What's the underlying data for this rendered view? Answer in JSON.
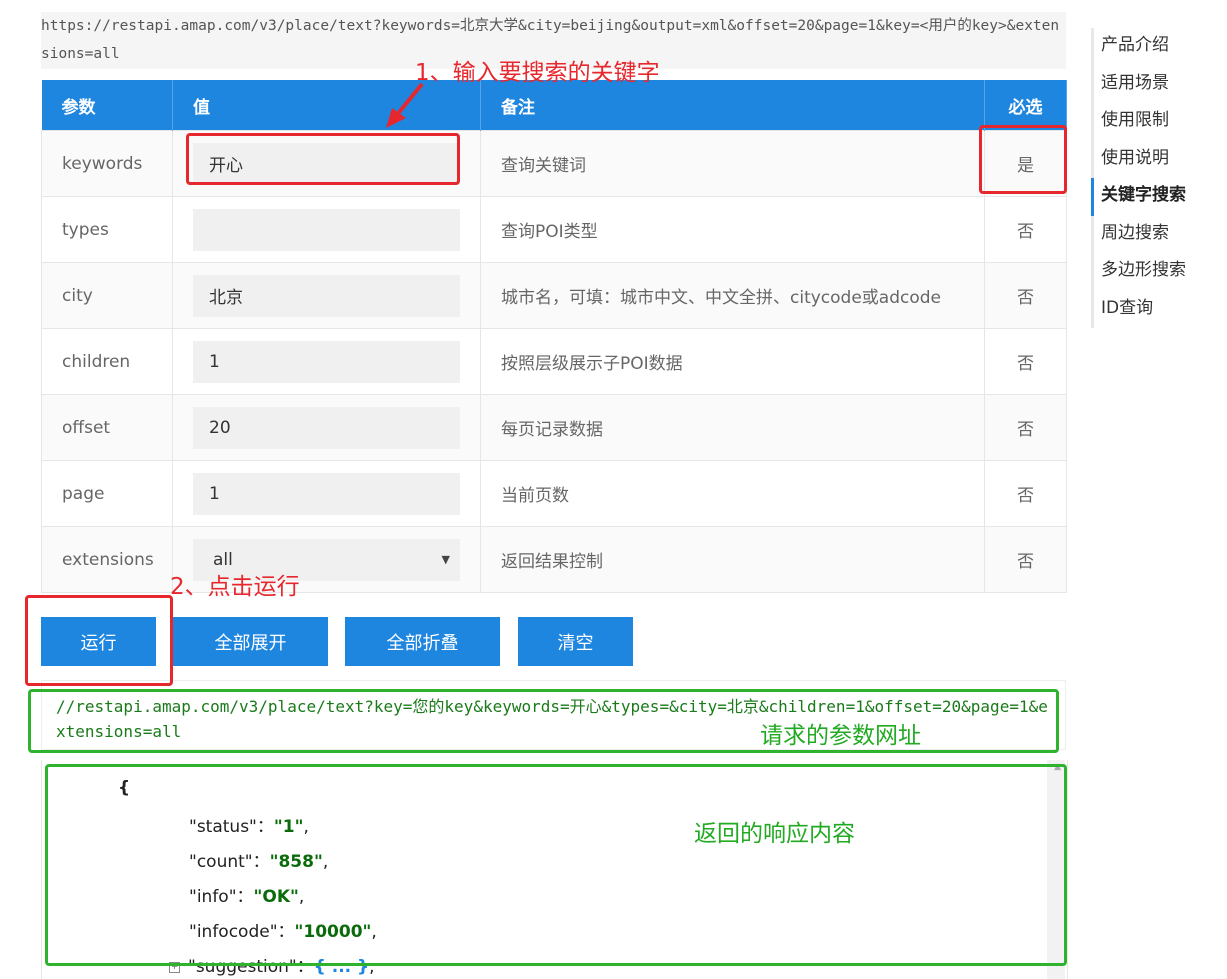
{
  "request_example_url": "https://restapi.amap.com/v3/place/text?keywords=北京大学&city=beijing&output=xml&offset=20&page=1&key=<用户的key>&extensions=all",
  "table": {
    "headers": [
      "参数",
      "值",
      "备注",
      "必选"
    ],
    "rows": [
      {
        "param": "keywords",
        "value": "开心",
        "note": "查询关键词",
        "required": "是"
      },
      {
        "param": "types",
        "value": "",
        "note": "查询POI类型",
        "required": "否"
      },
      {
        "param": "city",
        "value": "北京",
        "note": "城市名，可填：城市中文、中文全拼、citycode或adcode",
        "required": "否"
      },
      {
        "param": "children",
        "value": "1",
        "note": "按照层级展示子POI数据",
        "required": "否"
      },
      {
        "param": "offset",
        "value": "20",
        "note": "每页记录数据",
        "required": "否"
      },
      {
        "param": "page",
        "value": "1",
        "note": "当前页数",
        "required": "否"
      },
      {
        "param": "extensions",
        "value": "all",
        "note": "返回结果控制",
        "required": "否"
      }
    ]
  },
  "buttons": {
    "run": "运行",
    "expand_all": "全部展开",
    "collapse_all": "全部折叠",
    "clear": "清空"
  },
  "request_url": "//restapi.amap.com/v3/place/text?key=您的key&keywords=开心&types=&city=北京&children=1&offset=20&page=1&extensions=all",
  "response": {
    "open_brace": "{",
    "fields": [
      {
        "key": "\"status\"",
        "value": "\"1\""
      },
      {
        "key": "\"count\"",
        "value": "\"858\""
      },
      {
        "key": "\"info\"",
        "value": "\"OK\""
      },
      {
        "key": "\"infocode\"",
        "value": "\"10000\""
      }
    ],
    "collapsed_field": {
      "key": "\"suggestion\"",
      "value": "{ ... }"
    }
  },
  "side_nav": [
    {
      "label": "产品介绍",
      "active": false
    },
    {
      "label": "适用场景",
      "active": false
    },
    {
      "label": "使用限制",
      "active": false
    },
    {
      "label": "使用说明",
      "active": false
    },
    {
      "label": "关键字搜索",
      "active": true
    },
    {
      "label": "周边搜索",
      "active": false
    },
    {
      "label": "多边形搜索",
      "active": false
    },
    {
      "label": "ID查询",
      "active": false
    }
  ],
  "annotations": {
    "step1": "1、输入要搜索的关键字",
    "step2": "2、点击运行",
    "request_url_label": "请求的参数网址",
    "response_label": "返回的响应内容"
  },
  "colors": {
    "primary": "#1f86e0",
    "annotation_red": "#e6282e",
    "annotation_green": "#2fb32f"
  }
}
